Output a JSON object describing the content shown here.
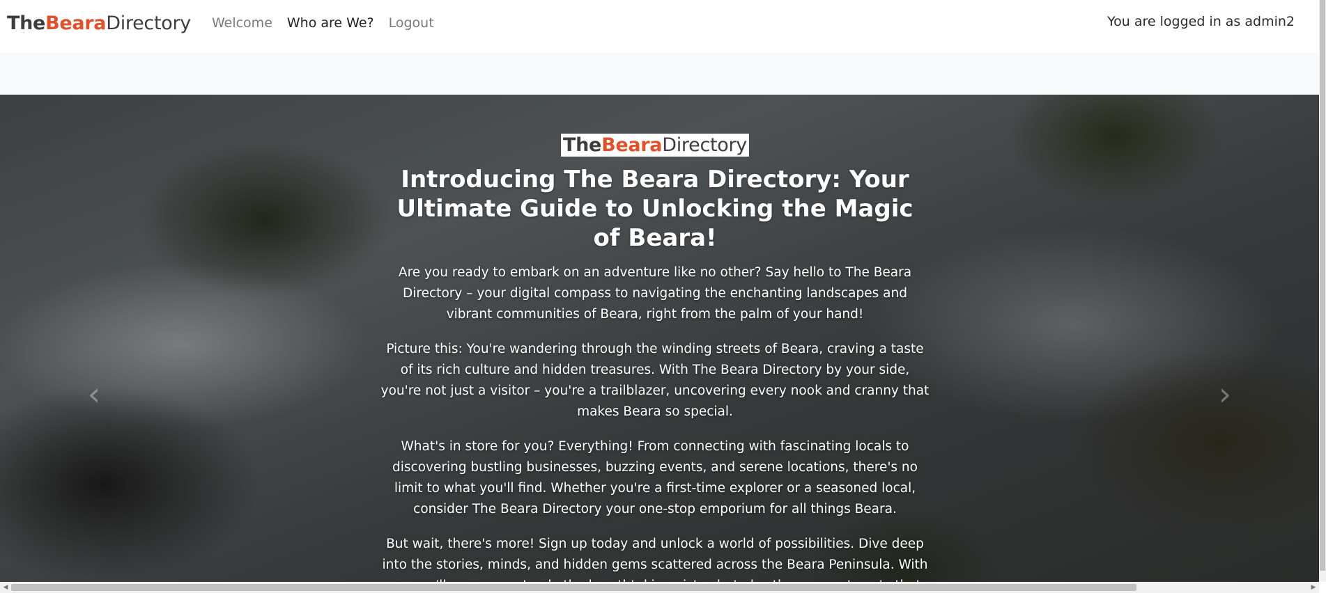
{
  "brand": {
    "part1": "The",
    "part2": "Beara",
    "part3": "Directory"
  },
  "nav": {
    "items": [
      {
        "label": "Welcome"
      },
      {
        "label": "Who are We?"
      },
      {
        "label": "Logout"
      }
    ]
  },
  "user": {
    "status": "You are logged in as admin2"
  },
  "hero": {
    "title": "Introducing The Beara Directory: Your Ultimate Guide to Unlocking the Magic of Beara!",
    "paragraphs": [
      "Are you ready to embark on an adventure like no other? Say hello to The Beara Directory – your digital compass to navigating the enchanting landscapes and vibrant communities of Beara, right from the palm of your hand!",
      "Picture this: You're wandering through the winding streets of Beara, craving a taste of its rich culture and hidden treasures. With The Beara Directory by your side, you're not just a visitor – you're a trailblazer, uncovering every nook and cranny that makes Beara so special.",
      "What's in store for you? Everything! From connecting with fascinating locals to discovering bustling businesses, buzzing events, and serene locations, there's no limit to what you'll find. Whether you're a first-time explorer or a seasoned local, consider The Beara Directory your one-stop emporium for all things Beara.",
      "But wait, there's more! Sign up today and unlock a world of possibilities. Dive deep into the stories, minds, and hidden gems scattered across the Beara Peninsula. With us, you'll uncover not only the breathtaking vistas but also those secret spots that whisper tales of ancient lore."
    ]
  },
  "carousel": {
    "prev_icon": "‹",
    "next_icon": "›"
  },
  "scrollbar": {
    "left_arrow": "◀",
    "right_arrow": "▶"
  },
  "colors": {
    "brand_accent": "#e0522c",
    "brand_text": "#3d3d3d"
  }
}
